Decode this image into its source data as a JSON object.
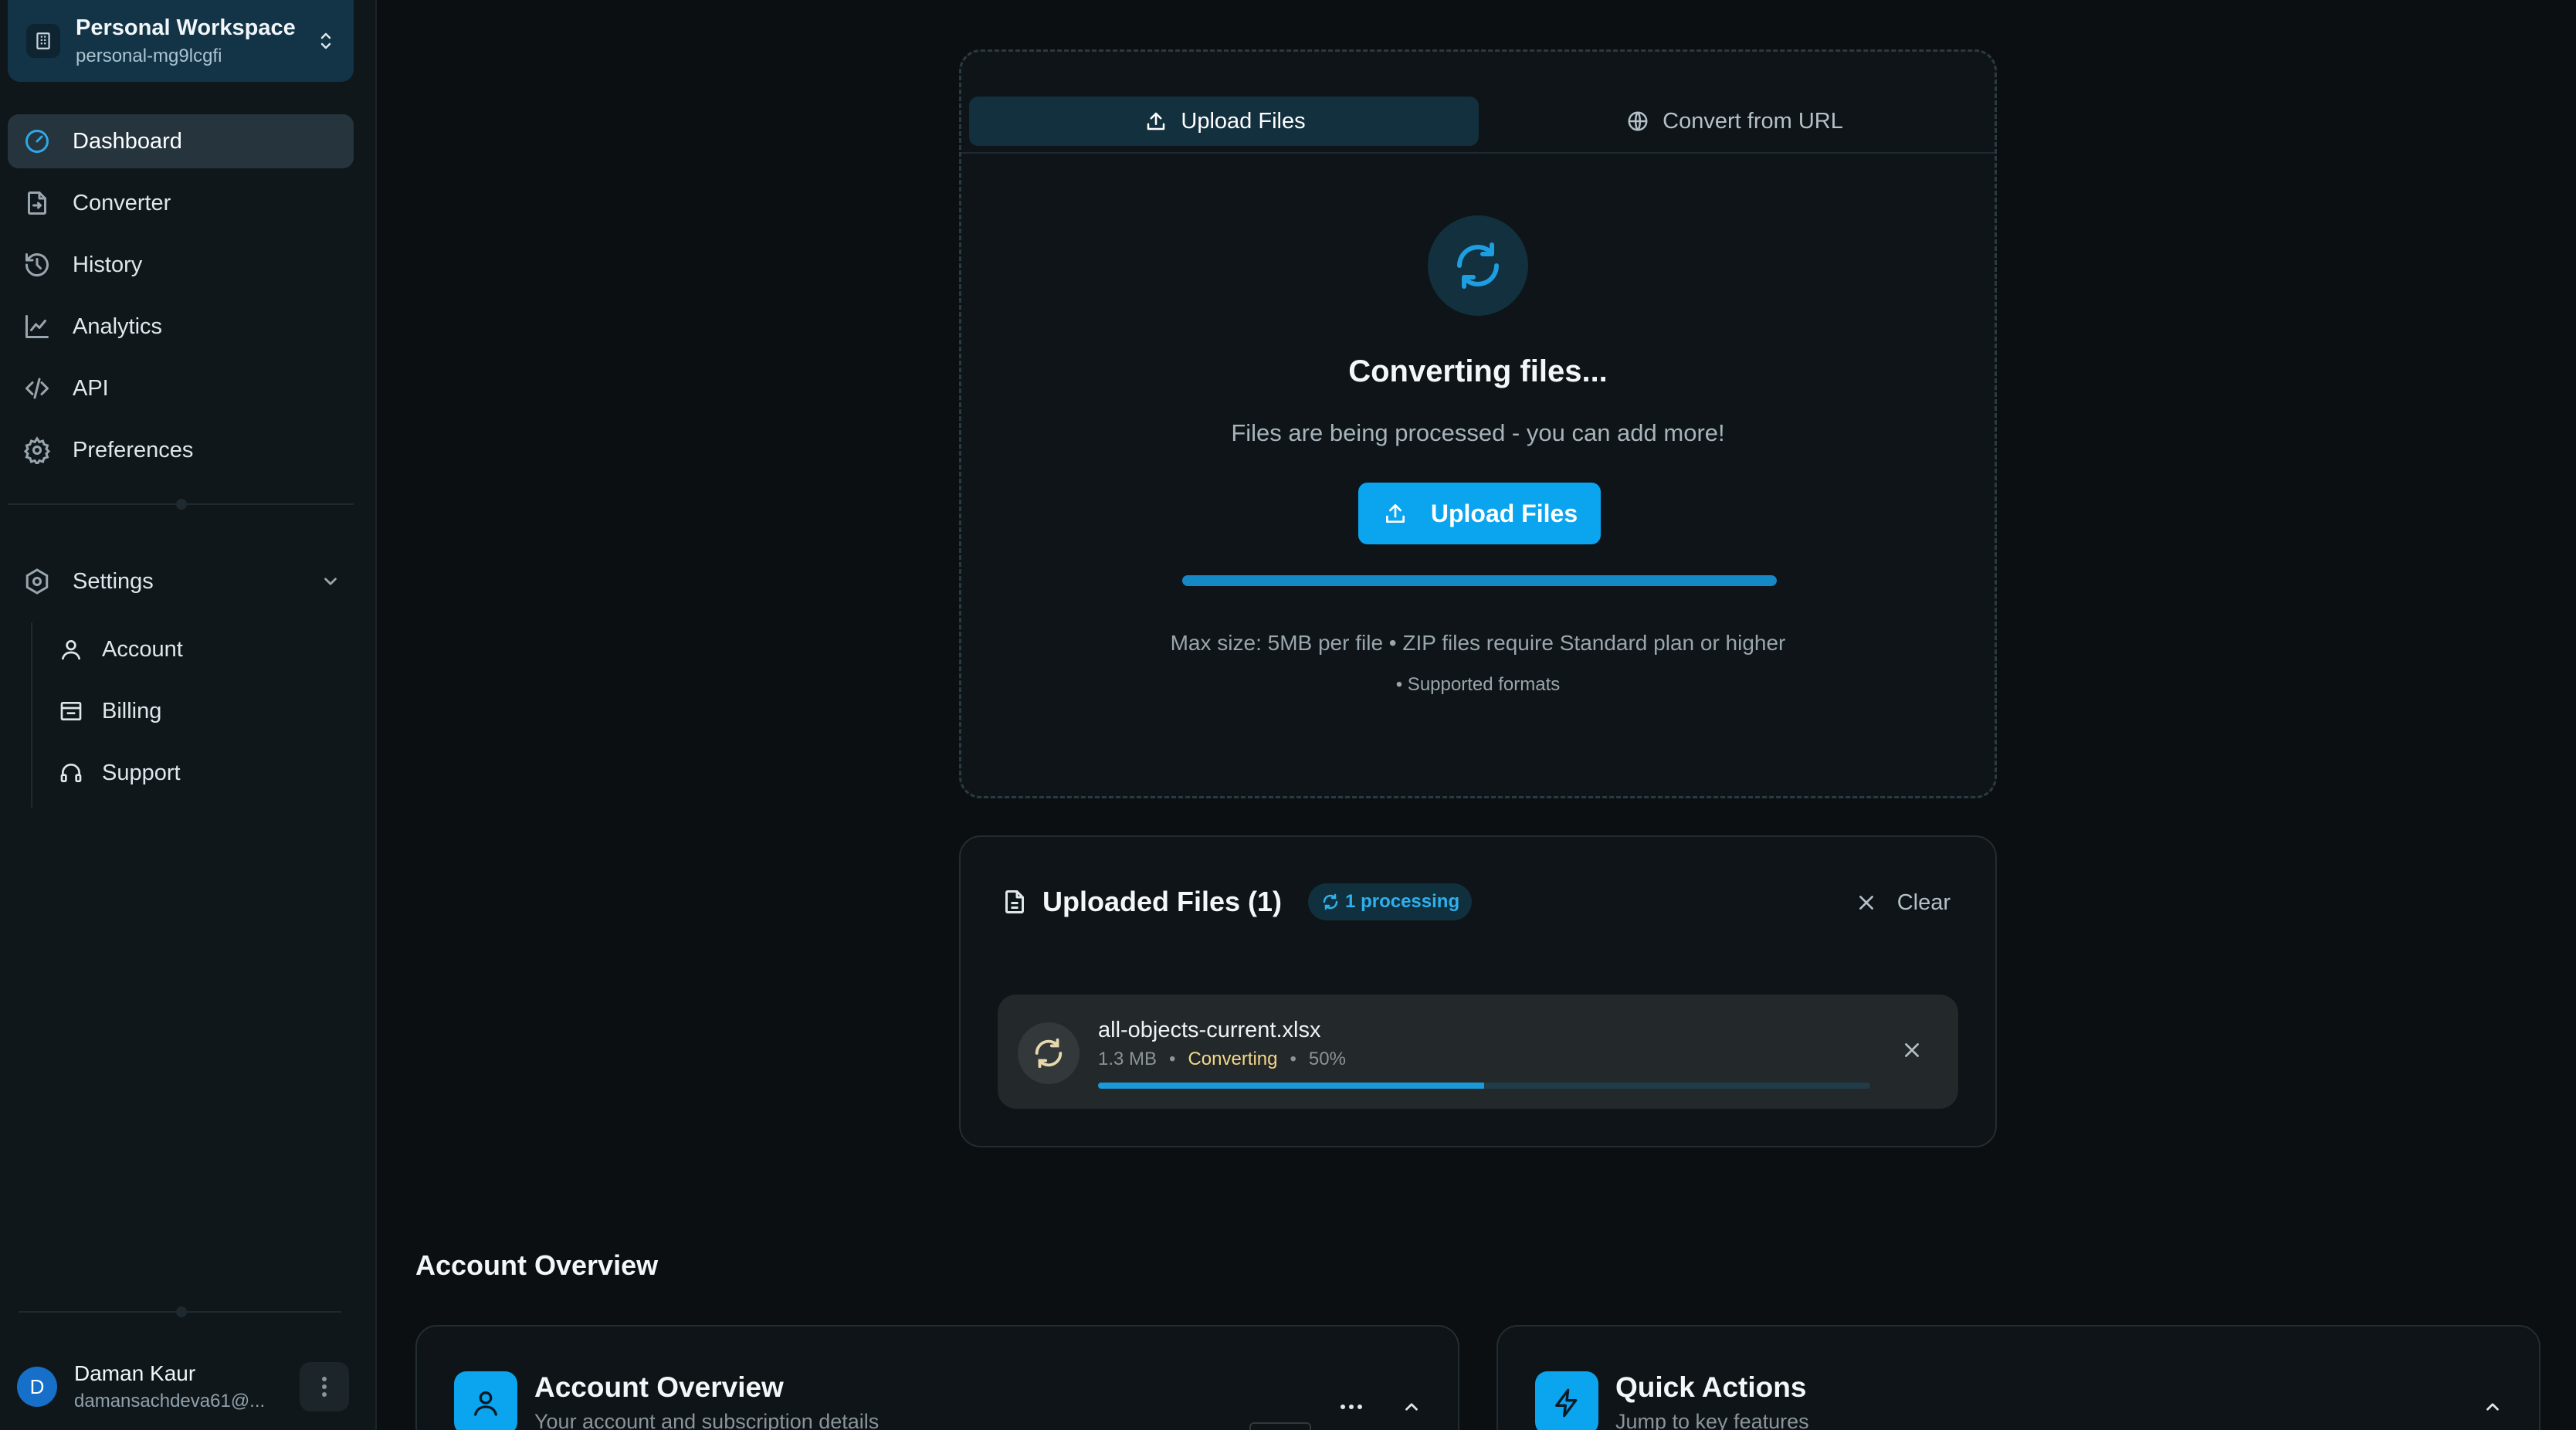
{
  "workspace": {
    "name": "Personal Workspace",
    "slug": "personal-mg9lcgfi"
  },
  "nav": [
    {
      "label": "Dashboard",
      "icon": "gauge-icon",
      "active": true
    },
    {
      "label": "Converter",
      "icon": "file-convert-icon"
    },
    {
      "label": "History",
      "icon": "history-icon"
    },
    {
      "label": "Analytics",
      "icon": "chart-line-icon"
    },
    {
      "label": "API",
      "icon": "code-icon"
    },
    {
      "label": "Preferences",
      "icon": "gear-icon"
    }
  ],
  "settings": {
    "label": "Settings",
    "items": [
      {
        "label": "Account",
        "icon": "user-icon"
      },
      {
        "label": "Billing",
        "icon": "billing-icon"
      },
      {
        "label": "Support",
        "icon": "headset-icon"
      }
    ]
  },
  "user": {
    "initial": "D",
    "name": "Daman Kaur",
    "email": "damansachdeva61@..."
  },
  "upload": {
    "tabs": [
      {
        "label": "Upload Files",
        "active": true
      },
      {
        "label": "Convert from URL"
      }
    ],
    "title": "Converting files...",
    "subtitle": "Files are being processed - you can add more!",
    "button_label": "Upload Files",
    "limits": "Max size: 5MB per file • ZIP files require Standard plan or higher",
    "formats": "• Supported formats"
  },
  "uploaded": {
    "title": "Uploaded Files (1)",
    "badge": "1 processing",
    "clear_label": "Clear",
    "files": [
      {
        "name": "all-objects-current.xlsx",
        "size": "1.3 MB",
        "status": "Converting",
        "percent_label": "50%",
        "progress": 0.5
      }
    ]
  },
  "overview": {
    "section_title": "Account Overview",
    "cards": [
      {
        "title": "Account Overview",
        "subtitle": "Your account and subscription details",
        "icon": "user-icon"
      },
      {
        "title": "Quick Actions",
        "subtitle": "Jump to key features",
        "icon": "lightning-icon"
      }
    ]
  },
  "colors": {
    "accent": "#0aa4ef",
    "status_converting": "#f4d78b"
  }
}
